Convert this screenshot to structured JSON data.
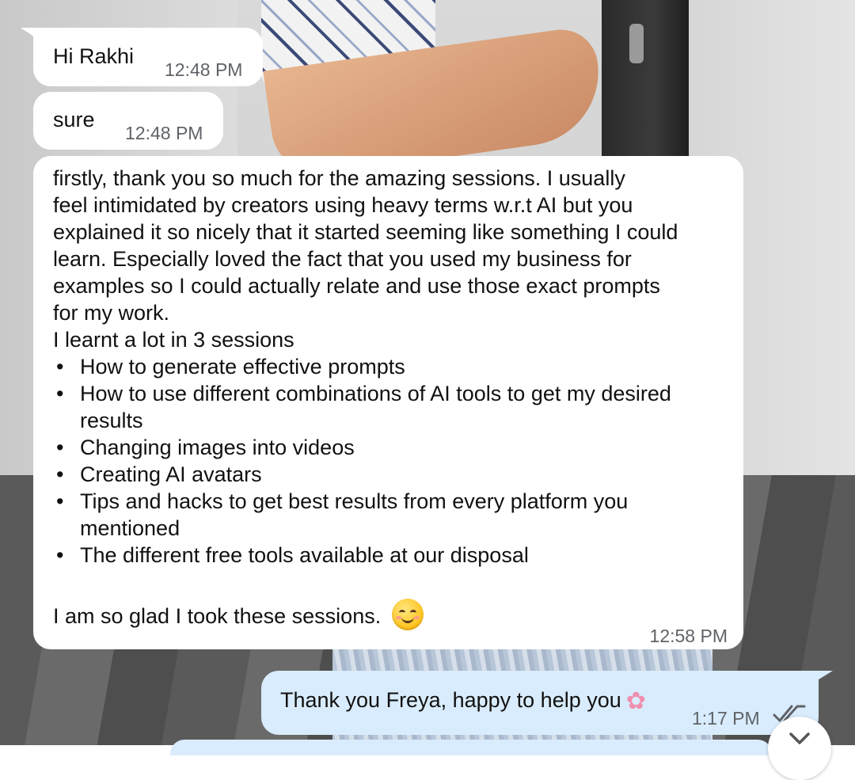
{
  "chat": {
    "messages": [
      {
        "direction": "incoming",
        "text": "Hi Rakhi",
        "time": "12:48 PM"
      },
      {
        "direction": "incoming",
        "text": "sure",
        "time": "12:48 PM"
      },
      {
        "direction": "incoming",
        "paragraph_lines": [
          "firstly, thank you so much for the amazing sessions. I usually",
          "feel intimidated by creators using heavy terms w.r.t AI but you",
          "explained it so nicely that it started seeming like something I could",
          "learn. Especially loved the fact that you used my business for",
          "examples so I could actually relate and use those exact prompts",
          "for my work.",
          "I learnt a lot in 3 sessions"
        ],
        "bullets": [
          "How to generate effective prompts",
          "How to use different combinations of AI tools to get my desired results",
          "Changing images into videos",
          "Creating AI avatars",
          "Tips and hacks to get best results from every platform you mentioned",
          "The different free tools available at our disposal"
        ],
        "closing": "I am so glad I took these sessions.",
        "emoji": "smiling-face-emoji",
        "time": "12:58 PM"
      },
      {
        "direction": "outgoing",
        "text": "Thank you Freya, happy to help you",
        "emoji": "cherry-blossom-emoji",
        "time": "1:17 PM",
        "status": "read"
      }
    ]
  },
  "icons": {
    "read_ticks": "double-check-icon",
    "scroll_down": "chevron-down-icon"
  },
  "colors": {
    "incoming_bubble": "#ffffff",
    "outgoing_bubble": "#d9ecfd",
    "timestamp": "#5f6368",
    "read_ticks": "#5f6368"
  }
}
